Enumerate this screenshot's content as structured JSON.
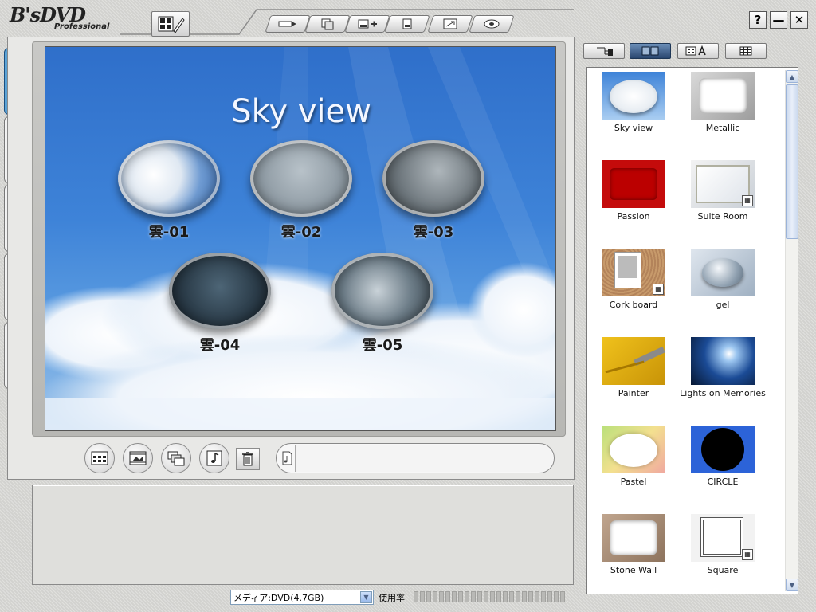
{
  "app": {
    "logo_main": "B'sDVD",
    "logo_sub": "Professional"
  },
  "window_controls": {
    "help": "?",
    "minimize": "—",
    "close": "✕"
  },
  "preview": {
    "menu_title": "Sky view",
    "chapters": [
      {
        "label": "雲-01"
      },
      {
        "label": "雲-02"
      },
      {
        "label": "雲-03"
      },
      {
        "label": "雲-04"
      },
      {
        "label": "雲-05"
      }
    ]
  },
  "status_bar": {
    "media_value": "メディア:DVD(4.7GB)",
    "usage_label": "使用率",
    "usage_fraction": 0
  },
  "templates": [
    {
      "name": "Sky view"
    },
    {
      "name": "Metallic"
    },
    {
      "name": "Passion"
    },
    {
      "name": "Suite Room"
    },
    {
      "name": "Cork board"
    },
    {
      "name": "gel"
    },
    {
      "name": "Painter"
    },
    {
      "name": "Lights on Memories"
    },
    {
      "name": "Pastel"
    },
    {
      "name": "CIRCLE"
    },
    {
      "name": "Stone Wall"
    },
    {
      "name": "Square"
    }
  ],
  "colors": {
    "sky_blue": "#3e83d8",
    "active_tab": "#1d6aa8",
    "panel": "#e8e8e6"
  }
}
